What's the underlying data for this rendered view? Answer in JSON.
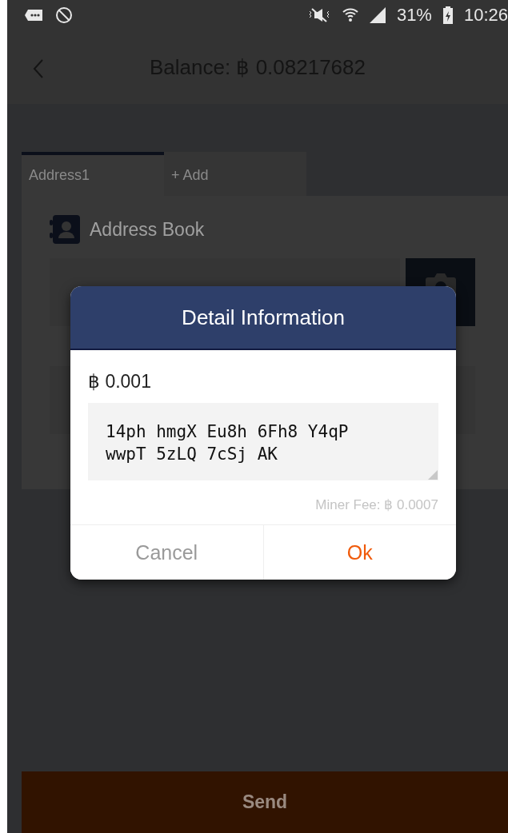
{
  "status_bar": {
    "battery": "31%",
    "time": "10:26"
  },
  "header": {
    "title": "Balance: ฿ 0.08217682"
  },
  "tabs": [
    {
      "label": "Address1",
      "selected": true
    },
    {
      "label": "+ Add",
      "selected": false
    }
  ],
  "address_book": {
    "label": "Address Book"
  },
  "dialog": {
    "title": "Detail Information",
    "amount": "฿ 0.001",
    "address": "14ph hmgX Eu8h 6Fh8 Y4qP wwpT 5zLQ 7cSj AK",
    "miner_fee": "Miner Fee: ฿ 0.0007",
    "buttons": [
      {
        "label": "Cancel",
        "kind": "cancel"
      },
      {
        "label": "Ok",
        "kind": "confirm"
      }
    ]
  },
  "send_button": {
    "label": "Send"
  }
}
